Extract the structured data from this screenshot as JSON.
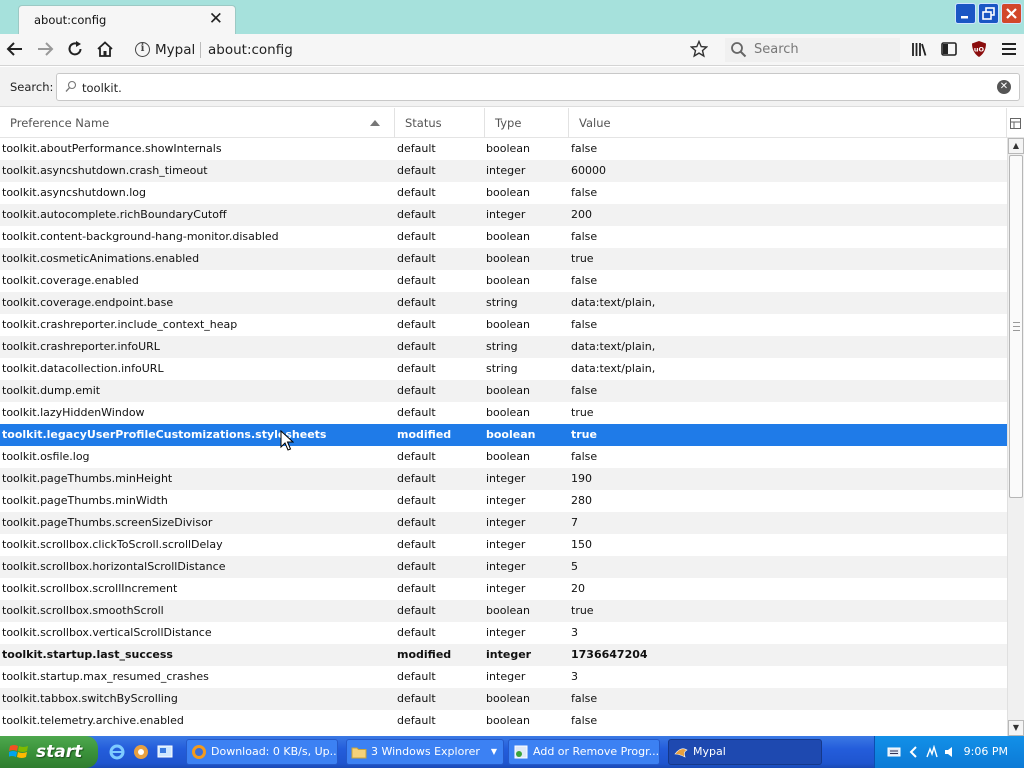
{
  "browser": {
    "tab_title": "about:config",
    "identity_label": "Mypal",
    "url": "about:config",
    "search_placeholder": "Search"
  },
  "config": {
    "search_label": "Search:",
    "filter_value": "toolkit.",
    "columns": [
      "Preference Name",
      "Status",
      "Type",
      "Value"
    ],
    "rows": [
      {
        "name": "toolkit.aboutPerformance.showInternals",
        "status": "default",
        "type": "boolean",
        "value": "false"
      },
      {
        "name": "toolkit.asyncshutdown.crash_timeout",
        "status": "default",
        "type": "integer",
        "value": "60000"
      },
      {
        "name": "toolkit.asyncshutdown.log",
        "status": "default",
        "type": "boolean",
        "value": "false"
      },
      {
        "name": "toolkit.autocomplete.richBoundaryCutoff",
        "status": "default",
        "type": "integer",
        "value": "200"
      },
      {
        "name": "toolkit.content-background-hang-monitor.disabled",
        "status": "default",
        "type": "boolean",
        "value": "false"
      },
      {
        "name": "toolkit.cosmeticAnimations.enabled",
        "status": "default",
        "type": "boolean",
        "value": "true"
      },
      {
        "name": "toolkit.coverage.enabled",
        "status": "default",
        "type": "boolean",
        "value": "false"
      },
      {
        "name": "toolkit.coverage.endpoint.base",
        "status": "default",
        "type": "string",
        "value": "data:text/plain,"
      },
      {
        "name": "toolkit.crashreporter.include_context_heap",
        "status": "default",
        "type": "boolean",
        "value": "false"
      },
      {
        "name": "toolkit.crashreporter.infoURL",
        "status": "default",
        "type": "string",
        "value": "data:text/plain,"
      },
      {
        "name": "toolkit.datacollection.infoURL",
        "status": "default",
        "type": "string",
        "value": "data:text/plain,"
      },
      {
        "name": "toolkit.dump.emit",
        "status": "default",
        "type": "boolean",
        "value": "false"
      },
      {
        "name": "toolkit.lazyHiddenWindow",
        "status": "default",
        "type": "boolean",
        "value": "true"
      },
      {
        "name": "toolkit.legacyUserProfileCustomizations.stylesheets",
        "status": "modified",
        "type": "boolean",
        "value": "true"
      },
      {
        "name": "toolkit.osfile.log",
        "status": "default",
        "type": "boolean",
        "value": "false"
      },
      {
        "name": "toolkit.pageThumbs.minHeight",
        "status": "default",
        "type": "integer",
        "value": "190"
      },
      {
        "name": "toolkit.pageThumbs.minWidth",
        "status": "default",
        "type": "integer",
        "value": "280"
      },
      {
        "name": "toolkit.pageThumbs.screenSizeDivisor",
        "status": "default",
        "type": "integer",
        "value": "7"
      },
      {
        "name": "toolkit.scrollbox.clickToScroll.scrollDelay",
        "status": "default",
        "type": "integer",
        "value": "150"
      },
      {
        "name": "toolkit.scrollbox.horizontalScrollDistance",
        "status": "default",
        "type": "integer",
        "value": "5"
      },
      {
        "name": "toolkit.scrollbox.scrollIncrement",
        "status": "default",
        "type": "integer",
        "value": "20"
      },
      {
        "name": "toolkit.scrollbox.smoothScroll",
        "status": "default",
        "type": "boolean",
        "value": "true"
      },
      {
        "name": "toolkit.scrollbox.verticalScrollDistance",
        "status": "default",
        "type": "integer",
        "value": "3"
      },
      {
        "name": "toolkit.startup.last_success",
        "status": "modified",
        "type": "integer",
        "value": "1736647204"
      },
      {
        "name": "toolkit.startup.max_resumed_crashes",
        "status": "default",
        "type": "integer",
        "value": "3"
      },
      {
        "name": "toolkit.tabbox.switchByScrolling",
        "status": "default",
        "type": "boolean",
        "value": "false"
      },
      {
        "name": "toolkit.telemetry.archive.enabled",
        "status": "default",
        "type": "boolean",
        "value": "false"
      }
    ],
    "selected_row": 13
  },
  "taskbar": {
    "start_label": "start",
    "tasks": [
      {
        "label": "Download: 0 KB/s, Up...",
        "icon": "firefox-icon"
      },
      {
        "label": "3 Windows Explorer",
        "icon": "folder-icon"
      },
      {
        "label": "Add or Remove Progr...",
        "icon": "control-panel-icon"
      },
      {
        "label": "Mypal",
        "icon": "mypal-icon"
      }
    ],
    "clock": "9:06 PM"
  },
  "colors": {
    "tabstrip": "#a6e1dc",
    "selection": "#1f7be8",
    "taskbar": "#245ddb",
    "start_button": "#3a923a"
  }
}
